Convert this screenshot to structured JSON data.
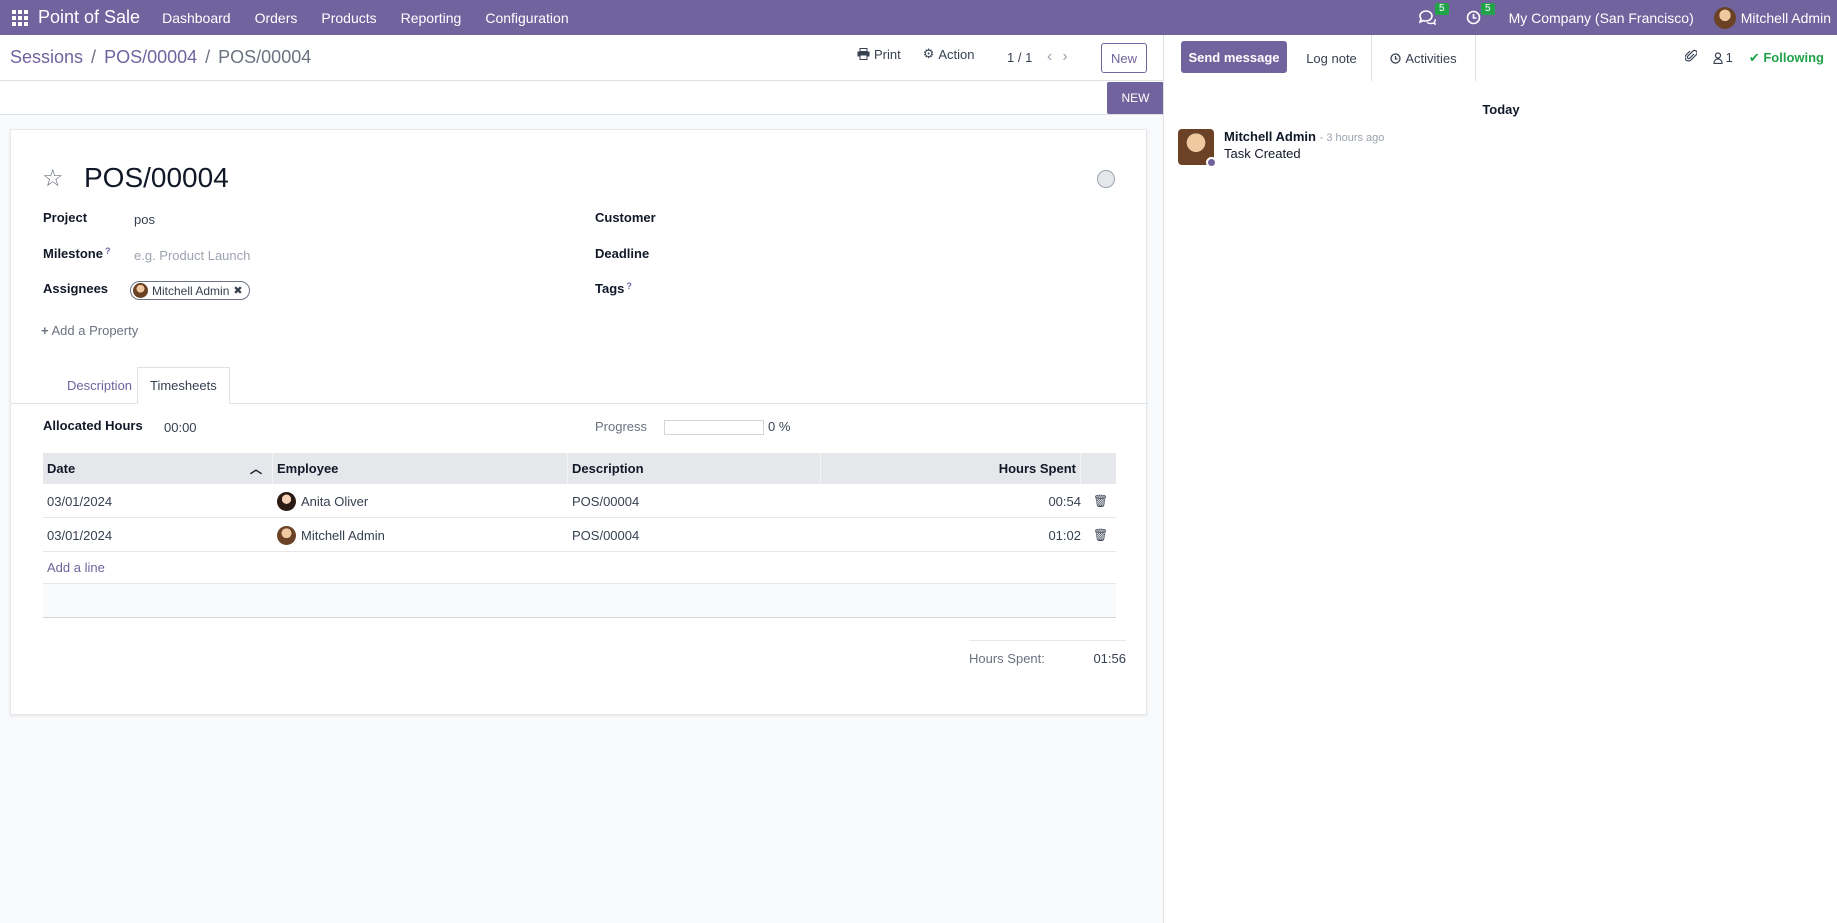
{
  "topbar": {
    "app_name": "Point of Sale",
    "menu": [
      "Dashboard",
      "Orders",
      "Products",
      "Reporting",
      "Configuration"
    ],
    "messages_count": "5",
    "activities_count": "5",
    "company": "My Company (San Francisco)",
    "user": "Mitchell Admin"
  },
  "breadcrumb": {
    "items": [
      "Sessions",
      "POS/00004"
    ],
    "separator": "/",
    "current": "POS/00004"
  },
  "control": {
    "print": "Print",
    "action": "Action",
    "pager": "1 / 1",
    "new": "New"
  },
  "statusbar": {
    "stage": "NEW"
  },
  "form": {
    "title": "POS/00004",
    "project_label": "Project",
    "project_value": "pos",
    "milestone_label": "Milestone",
    "milestone_placeholder": "e.g. Product Launch",
    "assignees_label": "Assignees",
    "assignee": "Mitchell Admin",
    "customer_label": "Customer",
    "deadline_label": "Deadline",
    "tags_label": "Tags",
    "help_mark": "?",
    "add_property": "Add a Property",
    "tabs": [
      "Description",
      "Timesheets"
    ],
    "allocated_label": "Allocated Hours",
    "allocated_value": "00:00",
    "progress_label": "Progress",
    "progress_value": "0 %",
    "progress_fraction": 0
  },
  "timesheets": {
    "columns": [
      "Date",
      "Employee",
      "Description",
      "Hours Spent"
    ],
    "rows": [
      {
        "date": "03/01/2024",
        "employee": "Anita Oliver",
        "description": "POS/00004",
        "hours": "00:54"
      },
      {
        "date": "03/01/2024",
        "employee": "Mitchell Admin",
        "description": "POS/00004",
        "hours": "01:02"
      }
    ],
    "add_line": "Add a line",
    "total_label": "Hours Spent:",
    "total_value": "01:56"
  },
  "chatter": {
    "send_message": "Send message",
    "log_note": "Log note",
    "activities": "Activities",
    "followers_count": "1",
    "following": "Following",
    "day": "Today",
    "message": {
      "author": "Mitchell Admin",
      "time": "- 3 hours ago",
      "body": "Task Created"
    }
  },
  "colors": {
    "brand": "#71639e",
    "following": "#22a34a",
    "badge": "#22a34a"
  }
}
